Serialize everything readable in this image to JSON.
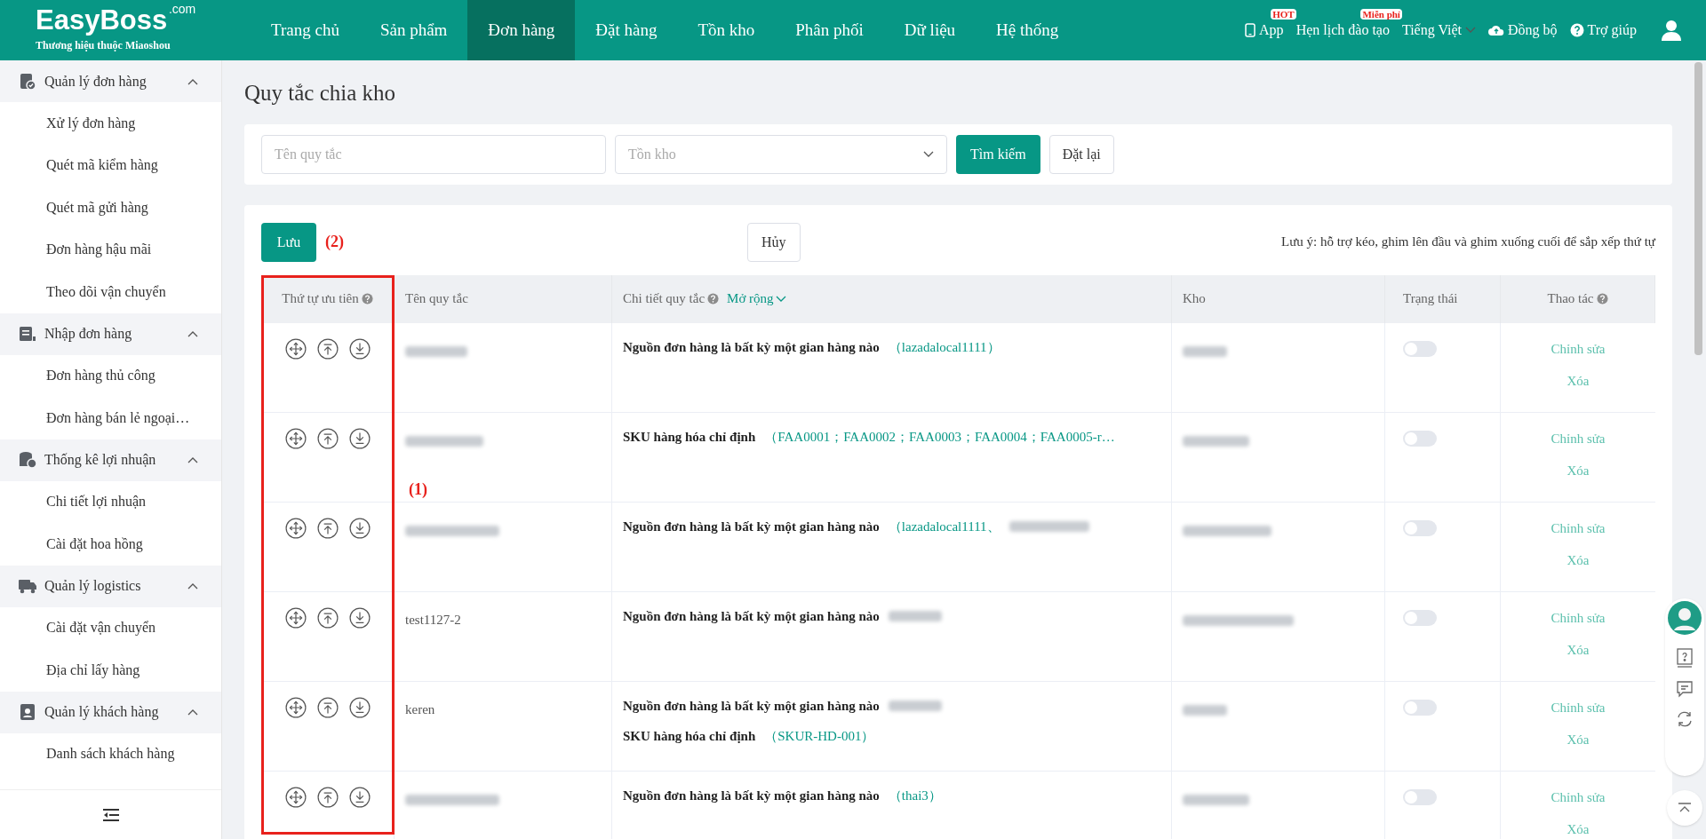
{
  "header": {
    "logo": "EasyBoss",
    "logo_suffix": ".com",
    "tagline": "Thương hiệu thuộc Miaoshou",
    "nav": [
      {
        "label": "Trang chủ",
        "selected": false
      },
      {
        "label": "Sản phẩm",
        "selected": false
      },
      {
        "label": "Đơn hàng",
        "selected": true
      },
      {
        "label": "Đặt hàng",
        "selected": false
      },
      {
        "label": "Tồn kho",
        "selected": false
      },
      {
        "label": "Phân phối",
        "selected": false
      },
      {
        "label": "Dữ liệu",
        "selected": false
      },
      {
        "label": "Hệ thống",
        "selected": false
      }
    ],
    "tools": [
      {
        "kind": "app",
        "label": "App",
        "badge": "HOT"
      },
      {
        "kind": "training",
        "label": "Hẹn lịch đào tạo",
        "badge": "Miễn phí"
      },
      {
        "kind": "language",
        "label": "Tiếng Việt"
      },
      {
        "kind": "sync",
        "label": "Đồng bộ"
      },
      {
        "kind": "help",
        "label": "Trợ giúp"
      },
      {
        "kind": "user"
      }
    ]
  },
  "sidebar": {
    "groups": [
      {
        "label": "Quản lý đơn hàng",
        "expanded": true,
        "children": [
          "Xử lý đơn hàng",
          "Quét mã kiểm hàng",
          "Quét mã gửi hàng",
          "Đơn hàng hậu mãi",
          "Theo dõi vận chuyển"
        ]
      },
      {
        "label": "Nhập đơn hàng",
        "expanded": true,
        "children": [
          "Đơn hàng thủ công",
          "Đơn hàng bán lẻ ngoại…"
        ]
      },
      {
        "label": "Thống kê lợi nhuận",
        "expanded": true,
        "children": [
          "Chi tiết lợi nhuận",
          "Cài đặt hoa hồng"
        ]
      },
      {
        "label": "Quản lý logistics",
        "expanded": true,
        "children": [
          "Cài đặt vận chuyển",
          "Địa chỉ lấy hàng"
        ]
      },
      {
        "label": "Quản lý khách hàng",
        "expanded": true,
        "children": [
          "Danh sách khách hàng"
        ]
      }
    ]
  },
  "page": {
    "title": "Quy tắc chia kho"
  },
  "filters": {
    "name_placeholder": "Tên quy tắc",
    "warehouse_placeholder": "Tồn kho",
    "search_button": "Tìm kiếm",
    "reset_button": "Đặt lại"
  },
  "toolbar": {
    "save": "Lưu",
    "cancel": "Hủy",
    "note": "Lưu ý: hỗ trợ kéo, ghim lên đầu và ghim xuống cuối để sắp xếp thứ tự"
  },
  "annotations": [
    {
      "label": "(1)"
    },
    {
      "label": "(2)"
    }
  ],
  "table": {
    "columns": [
      {
        "label": "Thứ tự ưu tiên",
        "help": true
      },
      {
        "label": "Tên quy tắc",
        "help": false
      },
      {
        "label": "Chi tiết quy tắc",
        "help": true,
        "expand": "Mở rộng"
      },
      {
        "label": "Kho",
        "help": false
      },
      {
        "label": "Trạng thái",
        "help": false
      },
      {
        "label": "Thao tác",
        "help": true
      }
    ],
    "rows": [
      {
        "name_hidden": true,
        "conditions": [
          {
            "label": "Nguồn đơn hàng là bất kỳ một gian hàng nào",
            "value": "（lazadalocal1111）",
            "more_hidden": false
          }
        ],
        "warehouse_hidden": true,
        "on": false,
        "actions": [
          "Chỉnh sửa",
          "Xóa"
        ]
      },
      {
        "name_hidden": true,
        "conditions": [
          {
            "label": "SKU hàng hóa chỉ định",
            "value": "（FAA0001；FAA0002；FAA0003；FAA0004；FAA0005-r…",
            "more_hidden": false
          }
        ],
        "warehouse_hidden": true,
        "on": false,
        "actions": [
          "Chỉnh sửa",
          "Xóa"
        ]
      },
      {
        "name_hidden": true,
        "conditions": [
          {
            "label": "Nguồn đơn hàng là bất kỳ một gian hàng nào",
            "value": "（lazadalocal1111、",
            "more_hidden": true
          }
        ],
        "warehouse_hidden": true,
        "on": false,
        "actions": [
          "Chỉnh sửa",
          "Xóa"
        ]
      },
      {
        "name_hidden": false,
        "name": "test1127-2",
        "conditions": [
          {
            "label": "Nguồn đơn hàng là bất kỳ một gian hàng nào",
            "more_hidden": true
          }
        ],
        "warehouse_hidden": true,
        "on": false,
        "actions": [
          "Chỉnh sửa",
          "Xóa"
        ]
      },
      {
        "name_hidden": false,
        "name": "keren",
        "conditions": [
          {
            "label": "Nguồn đơn hàng là bất kỳ một gian hàng nào",
            "more_hidden": true
          },
          {
            "label": "SKU hàng hóa chỉ định",
            "value": "（SKUR-HD-001）",
            "more_hidden": false
          }
        ],
        "warehouse_hidden": true,
        "on": false,
        "actions": [
          "Chỉnh sửa",
          "Xóa"
        ]
      },
      {
        "name_hidden": true,
        "conditions": [
          {
            "label": "Nguồn đơn hàng là bất kỳ một gian hàng nào",
            "value": "（thai3）",
            "more_hidden": false
          }
        ],
        "warehouse_hidden": true,
        "on": false,
        "actions": [
          "Chỉnh sửa",
          "Xóa"
        ]
      }
    ]
  }
}
